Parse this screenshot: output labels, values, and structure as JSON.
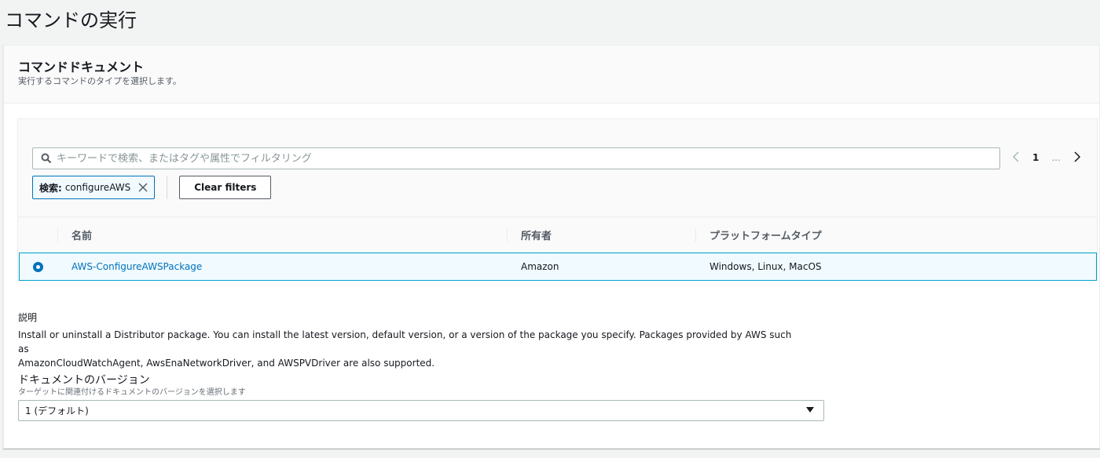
{
  "page": {
    "title": "コマンドの実行"
  },
  "section": {
    "title": "コマンドドキュメント",
    "description": "実行するコマンドのタイプを選択します。"
  },
  "search": {
    "placeholder": "キーワードで検索、またはタグや属性でフィルタリング",
    "value": ""
  },
  "pagination": {
    "prev": "‹",
    "page": "1",
    "ellipsis": "...",
    "next": "›"
  },
  "filter": {
    "token_key": "検索:",
    "token_value": "configureAWS",
    "clear_label": "Clear filters"
  },
  "table": {
    "columns": [
      "名前",
      "所有者",
      "プラットフォームタイプ"
    ],
    "rows": [
      {
        "name": "AWS-ConfigureAWSPackage",
        "owner": "Amazon",
        "platform": "Windows, Linux, MacOS",
        "selected": true
      }
    ]
  },
  "details": {
    "description_label": "説明",
    "description_line1": "Install or uninstall a Distributor package. You can install the latest version, default version, or a version of the package you specify. Packages provided by AWS such as",
    "description_line2": "AmazonCloudWatchAgent, AwsEnaNetworkDriver, and AWSPVDriver are also supported.",
    "version_label": "ドキュメントのバージョン",
    "version_hint": "ターゲットに関連付けるドキュメントのバージョンを選択します",
    "version_value": "1 (デフォルト)"
  },
  "colors": {
    "accent": "#0073bb",
    "selected_row_bg": "#f1faff",
    "selected_row_border": "#00a1c9"
  }
}
